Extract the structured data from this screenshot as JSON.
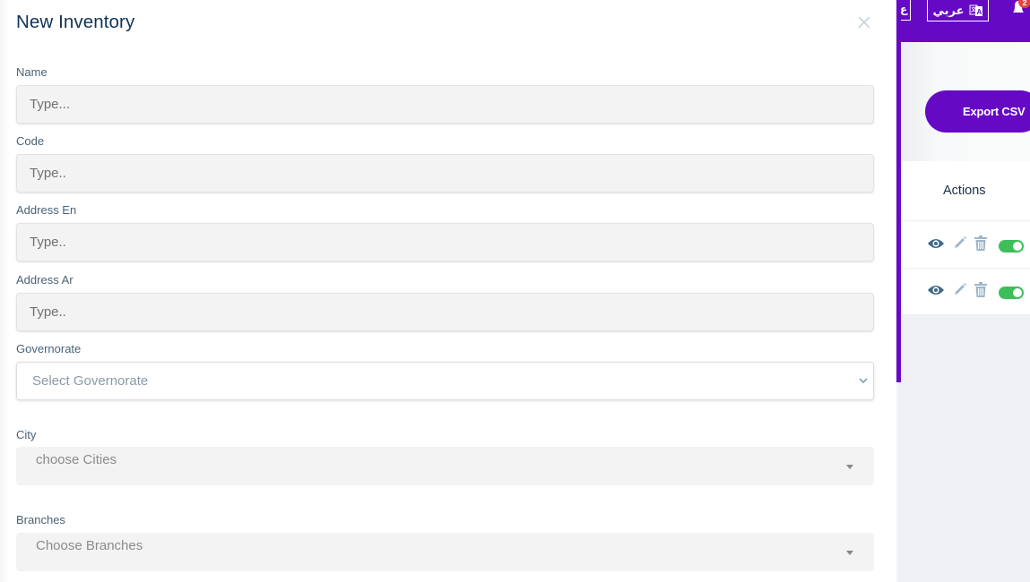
{
  "modal": {
    "title": "New Inventory",
    "close_icon": "close-icon",
    "fields": {
      "name": {
        "label": "Name",
        "placeholder": "Type..."
      },
      "code": {
        "label": "Code",
        "placeholder": "Type.."
      },
      "address_en": {
        "label": "Address En",
        "placeholder": "Type.."
      },
      "address_ar": {
        "label": "Address Ar",
        "placeholder": "Type.."
      },
      "governorate": {
        "label": "Governorate",
        "selected": "Select Governorate"
      },
      "city": {
        "label": "City",
        "placeholder": "choose Cities"
      },
      "branches": {
        "label": "Branches",
        "placeholder": "Choose Branches"
      }
    }
  },
  "background": {
    "topbar": {
      "language_cut_label": "ع",
      "language_button_label": "عربي",
      "notification_count": "2",
      "accent_color": "#6609c4"
    },
    "export_button_label": "Export CSV",
    "table": {
      "actions_header": "Actions",
      "rows": [
        {
          "view": "eye-icon",
          "edit": "pencil-icon",
          "delete": "trash-icon",
          "active": true
        },
        {
          "view": "eye-icon",
          "edit": "pencil-icon",
          "delete": "trash-icon",
          "active": true
        }
      ]
    }
  }
}
